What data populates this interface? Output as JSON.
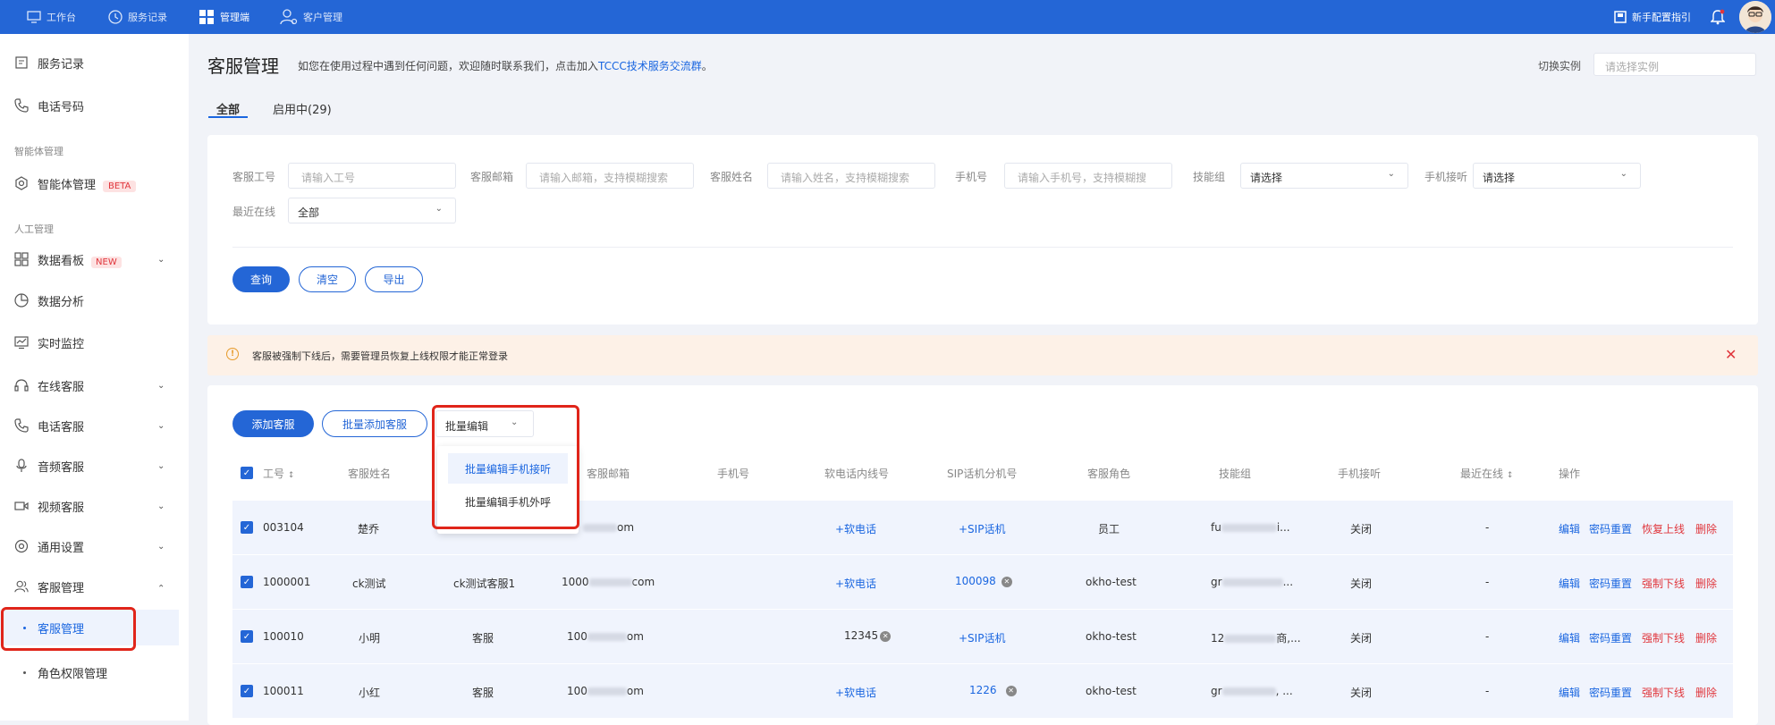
{
  "topbar": {
    "nav": [
      {
        "label": "工作台",
        "icon": "monitor-icon"
      },
      {
        "label": "服务记录",
        "icon": "clock-icon"
      },
      {
        "label": "管理端",
        "icon": "grid-icon"
      },
      {
        "label": "客户管理",
        "icon": "user-settings-icon"
      }
    ],
    "guide": "新手配置指引"
  },
  "sidebar": {
    "service_record": "服务记录",
    "phone_number": "电话号码",
    "group_agent": "智能体管理",
    "agent_mgmt": "智能体管理",
    "beta": "BETA",
    "group_manual": "人工管理",
    "dashboard": "数据看板",
    "new": "NEW",
    "analysis": "数据分析",
    "monitor": "实时监控",
    "online_service": "在线客服",
    "phone_service": "电话客服",
    "audio_service": "音频客服",
    "video_service": "视频客服",
    "general_settings": "通用设置",
    "agent_management": "客服管理",
    "sub_agent_mgmt": "客服管理",
    "sub_role_mgmt": "角色权限管理"
  },
  "header": {
    "title": "客服管理",
    "desc_prefix": "如您在使用过程中遇到任何问题，欢迎随时联系我们，点击加入",
    "desc_link": "TCCC技术服务交流群",
    "desc_suffix": "。",
    "switch_label": "切换实例",
    "switch_placeholder": "请选择实例"
  },
  "tabs": {
    "all": "全部",
    "enabled": "启用中(29)"
  },
  "filters": {
    "id_label": "客服工号",
    "id_placeholder": "请输入工号",
    "email_label": "客服邮箱",
    "email_placeholder": "请输入邮箱，支持模糊搜索",
    "name_label": "客服姓名",
    "name_placeholder": "请输入姓名，支持模糊搜索",
    "phone_label": "手机号",
    "phone_placeholder": "请输入手机号，支持模糊搜",
    "skill_label": "技能组",
    "skill_value": "请选择",
    "answer_label": "手机接听",
    "answer_value": "请选择",
    "recent_label": "最近在线",
    "recent_value": "全部",
    "query": "查询",
    "clear": "清空",
    "export": "导出"
  },
  "notice": "客服被强制下线后，需要管理员恢复上线权限才能正常登录",
  "actions": {
    "add": "添加客服",
    "batch_add": "批量添加客服",
    "batch_edit": "批量编辑",
    "dropdown": [
      "批量编辑手机接听",
      "批量编辑手机外呼"
    ]
  },
  "table": {
    "headers": [
      "工号",
      "客服姓名",
      "客服邮箱",
      "手机号",
      "软电话内线号",
      "SIP话机分机号",
      "客服角色",
      "技能组",
      "手机接听",
      "最近在线",
      "操作"
    ],
    "rows": [
      {
        "id": "003104",
        "name": "楚乔",
        "nick": "",
        "email_a": "",
        "email_b": "om",
        "soft": "+软电话",
        "sip": "+SIP话机",
        "role": "员工",
        "skill_a": "fu",
        "skill_b": "i...",
        "answer": "关闭",
        "recent": "-",
        "ops": [
          "编辑",
          "密码重置",
          "恢复上线",
          "删除"
        ]
      },
      {
        "id": "1000001",
        "name": "ck测试",
        "nick": "ck测试客服1",
        "email_a": "1000",
        "email_b": "com",
        "soft": "+软电话",
        "sip": "100098",
        "role": "okho-test",
        "skill_a": "gr",
        "skill_b": "...",
        "answer": "关闭",
        "recent": "-",
        "ops": [
          "编辑",
          "密码重置",
          "强制下线",
          "删除"
        ]
      },
      {
        "id": "100010",
        "name": "小明",
        "nick": "客服",
        "email_a": "100",
        "email_b": "om",
        "soft": "12345",
        "sip": "+SIP话机",
        "role": "okho-test",
        "skill_a": "12",
        "skill_b": "商,...",
        "answer": "关闭",
        "recent": "-",
        "ops": [
          "编辑",
          "密码重置",
          "强制下线",
          "删除"
        ]
      },
      {
        "id": "100011",
        "name": "小红",
        "nick": "客服",
        "email_a": "100",
        "email_b": "om",
        "soft": "+软电话",
        "sip": "1226",
        "role": "okho-test",
        "skill_a": "gr",
        "skill_b": ", ...",
        "answer": "关闭",
        "recent": "-",
        "ops": [
          "编辑",
          "密码重置",
          "强制下线",
          "删除"
        ]
      }
    ]
  },
  "colors": {
    "primary": "#2466d6",
    "danger": "#e0363c",
    "highlight": "#e0251a"
  }
}
